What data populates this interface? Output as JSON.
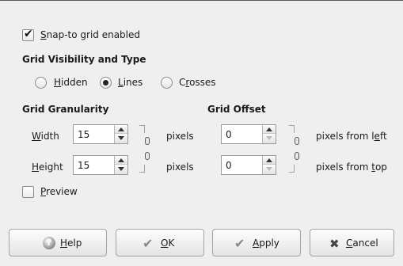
{
  "snap_to_grid": {
    "label": "Snap-to grid enabled",
    "mnemonic": "S",
    "rest": "nap-to grid enabled",
    "checked": true
  },
  "visibility": {
    "heading": "Grid Visibility and Type",
    "options": [
      {
        "label": "Hidden",
        "mnemonic": "H",
        "rest": "idden",
        "selected": false
      },
      {
        "label": "Lines",
        "mnemonic": "L",
        "rest": "ines",
        "selected": true
      },
      {
        "label": "Crosses",
        "pre": "C",
        "mnemonic": "r",
        "rest": "osses",
        "selected": false
      }
    ]
  },
  "granularity": {
    "heading": "Grid Granularity",
    "width": {
      "label": "Width",
      "mnemonic": "W",
      "rest": "idth",
      "value": "15",
      "unit": "pixels"
    },
    "height": {
      "label": "Height",
      "mnemonic": "H",
      "rest": "eight",
      "value": "15",
      "unit": "pixels"
    }
  },
  "offset": {
    "heading": "Grid Offset",
    "left": {
      "value": "0",
      "unit": "pixels from left",
      "unit_pre": "pixels from l",
      "mnemonic": "e",
      "unit_post": "ft"
    },
    "top": {
      "value": "0",
      "unit": "pixels from top",
      "unit_pre": "pixels from ",
      "mnemonic": "t",
      "unit_post": "op"
    }
  },
  "preview": {
    "label": "Preview",
    "mnemonic": "P",
    "rest": "review",
    "checked": false
  },
  "buttons": {
    "help": {
      "label": "Help",
      "mnemonic": "H",
      "rest": "elp"
    },
    "ok": {
      "label": "OK",
      "mnemonic": "O",
      "rest": "K"
    },
    "apply": {
      "label": "Apply",
      "mnemonic": "A",
      "rest": "pply"
    },
    "cancel": {
      "label": "Cancel",
      "mnemonic": "C",
      "rest": "ancel"
    }
  },
  "icons": {
    "help": "help-icon",
    "ok": "checkmark-icon",
    "apply": "checkmark-icon",
    "cancel": "close-icon",
    "chain": "chain-link-icon"
  }
}
